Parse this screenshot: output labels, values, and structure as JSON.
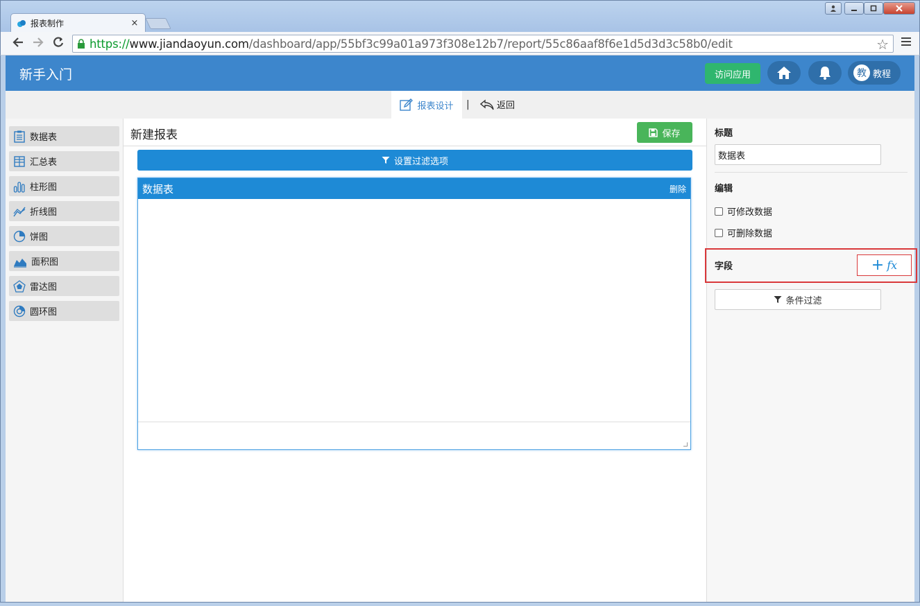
{
  "browser": {
    "tab_title": "报表制作",
    "tab_close": "×",
    "url_scheme": "https://",
    "url_host": "www.jiandaoyun.com",
    "url_path": "/dashboard/app/55bf3c99a01a973f308e12b7/report/55c86aaf8f6e1d5d3d3c58b0/edit"
  },
  "header": {
    "title": "新手入门",
    "visit_app_label": "访问应用",
    "tutorial_badge": "教",
    "tutorial_label": "教程",
    "accent_color": "#3d86cc"
  },
  "subnav": {
    "design_label": "报表设计",
    "separator": "|",
    "back_label": "返回"
  },
  "chart_types": [
    {
      "label": "数据表",
      "icon": "table-icon"
    },
    {
      "label": "汇总表",
      "icon": "summary-table-icon"
    },
    {
      "label": "柱形图",
      "icon": "bar-chart-icon"
    },
    {
      "label": "折线图",
      "icon": "line-chart-icon"
    },
    {
      "label": "饼图",
      "icon": "pie-chart-icon"
    },
    {
      "label": "面积图",
      "icon": "area-chart-icon"
    },
    {
      "label": "雷达图",
      "icon": "radar-chart-icon"
    },
    {
      "label": "圆环图",
      "icon": "donut-chart-icon"
    }
  ],
  "editor": {
    "report_title": "新建报表",
    "save_label": "保存",
    "filter_bar_label": "设置过滤选项",
    "widget_title": "数据表",
    "widget_delete": "删除"
  },
  "properties": {
    "title_label": "标题",
    "title_value": "数据表",
    "edit_label": "编辑",
    "can_edit_label": "可修改数据",
    "can_delete_label": "可删除数据",
    "fields_label": "字段",
    "add_field_plus": "+",
    "add_field_fx": "fx",
    "condition_filter_label": "条件过滤"
  }
}
